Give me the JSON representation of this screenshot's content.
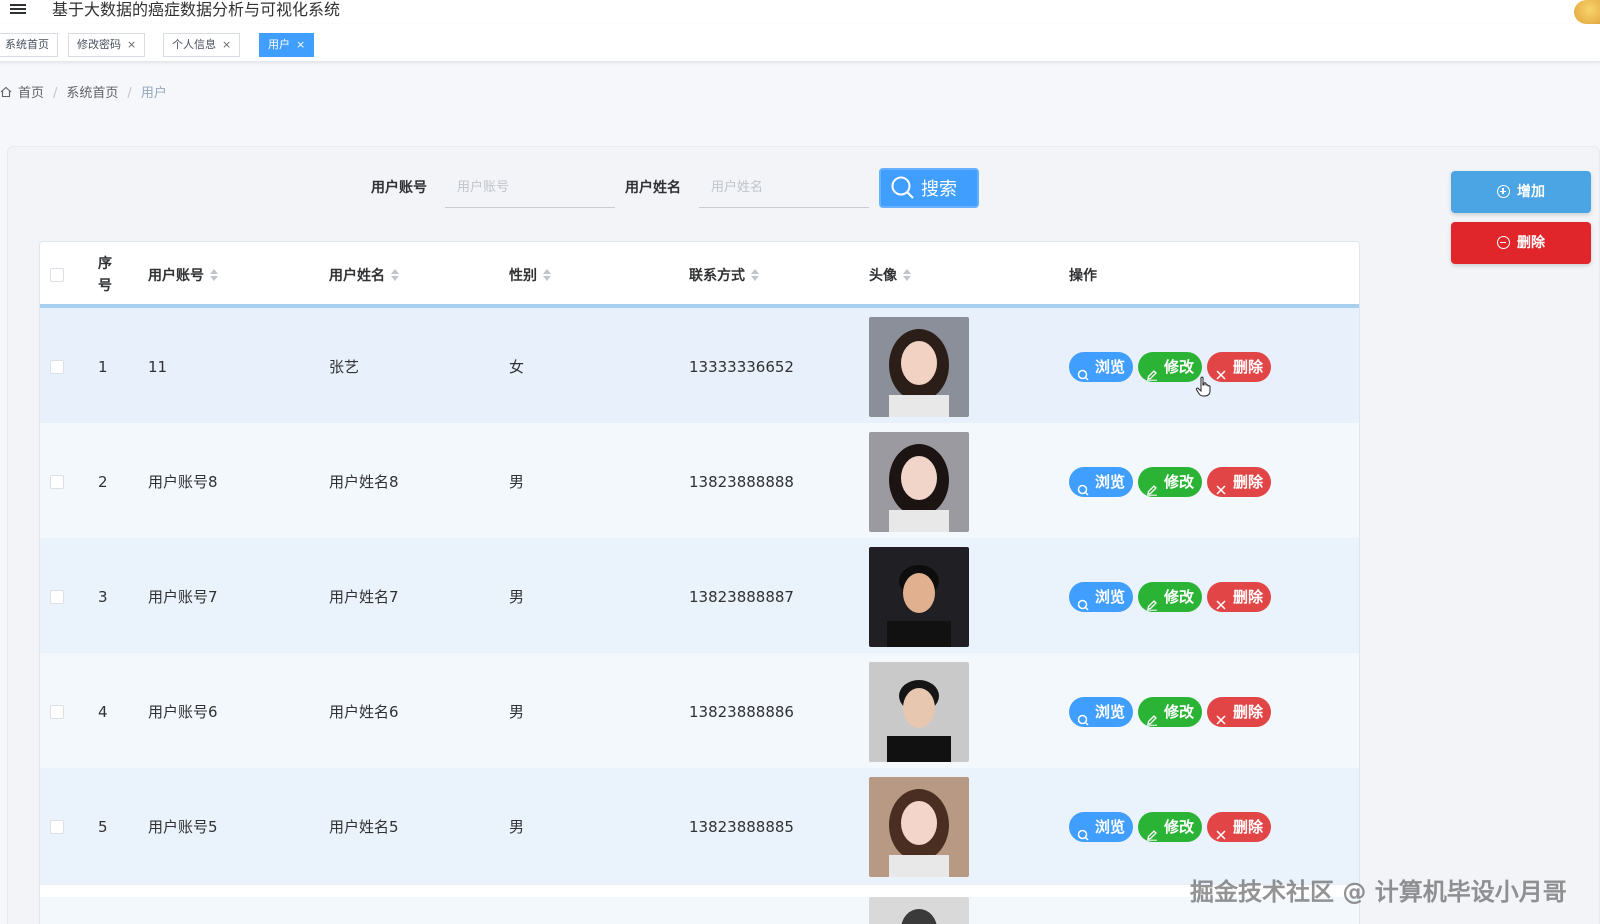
{
  "header": {
    "title": "基于大数据的癌症数据分析与可视化系统"
  },
  "tabs": [
    {
      "label": "系统首页",
      "closable": false,
      "active": false
    },
    {
      "label": "修改密码",
      "closable": true,
      "active": false
    },
    {
      "label": "个人信息",
      "closable": true,
      "active": false
    },
    {
      "label": "用户",
      "closable": true,
      "active": true
    }
  ],
  "tab_close_glyph": "×",
  "breadcrumb": {
    "items": [
      "首页",
      "系统首页",
      "用户"
    ],
    "separator": "/"
  },
  "search": {
    "account_label": "用户账号",
    "account_placeholder": "用户账号",
    "name_label": "用户姓名",
    "name_placeholder": "用户姓名",
    "button_label": "搜索"
  },
  "actions": {
    "add_label": "增加",
    "delete_label": "删除"
  },
  "table": {
    "headers": {
      "index": [
        "序",
        "号"
      ],
      "account": "用户账号",
      "name": "用户姓名",
      "gender": "性别",
      "phone": "联系方式",
      "avatar": "头像",
      "ops": "操作"
    },
    "op_labels": {
      "view": "浏览",
      "edit": "修改",
      "delete": "删除"
    },
    "rows": [
      {
        "index": "1",
        "account": "11",
        "name": "张艺",
        "gender": "女",
        "phone": "13333336652",
        "avatar": "female-portrait"
      },
      {
        "index": "2",
        "account": "用户账号8",
        "name": "用户姓名8",
        "gender": "男",
        "phone": "13823888888",
        "avatar": "female-portrait"
      },
      {
        "index": "3",
        "account": "用户账号7",
        "name": "用户姓名7",
        "gender": "男",
        "phone": "13823888887",
        "avatar": "male-portrait"
      },
      {
        "index": "4",
        "account": "用户账号6",
        "name": "用户姓名6",
        "gender": "男",
        "phone": "13823888886",
        "avatar": "male-portrait"
      },
      {
        "index": "5",
        "account": "用户账号5",
        "name": "用户姓名5",
        "gender": "男",
        "phone": "13823888885",
        "avatar": "female-portrait"
      }
    ]
  },
  "watermark": "掘金技术社区 @ 计算机毕设小月哥",
  "colors": {
    "primary": "#409eff",
    "success": "#2bb335",
    "danger": "#e14546",
    "add_button": "#4ba4e4",
    "batch_delete_button": "#e1262b"
  }
}
